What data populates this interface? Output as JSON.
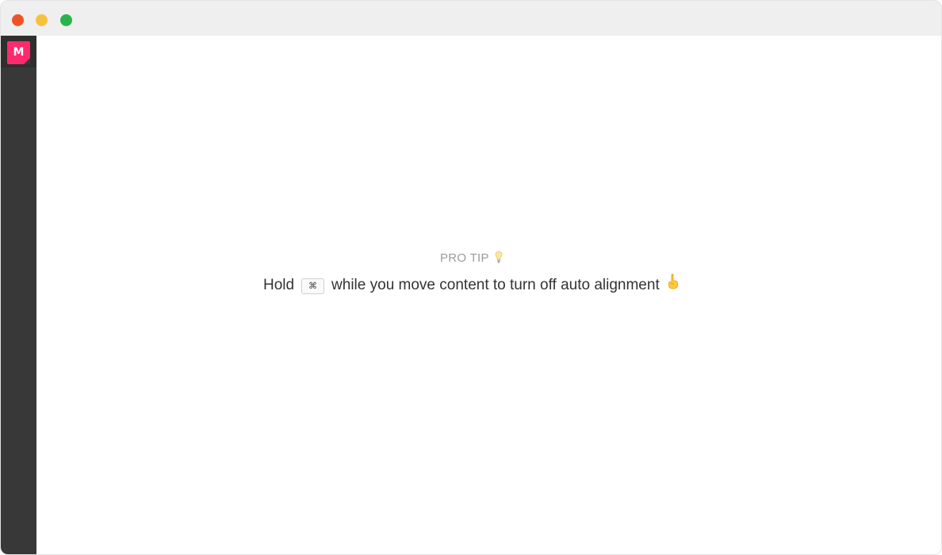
{
  "window": {
    "traffic_lights": {
      "close": "#f05228",
      "minimize": "#f4c23e",
      "maximize": "#27b54b"
    }
  },
  "sidebar": {
    "logo_text": "M",
    "logo_color": "#ff2a6d"
  },
  "tip": {
    "label": "PRO TIP",
    "text_before": "Hold",
    "key": "⌘",
    "text_after": "while you move content to turn off auto alignment",
    "label_icon": "light-bulb-icon",
    "end_icon": "pointing-up-finger-icon"
  }
}
